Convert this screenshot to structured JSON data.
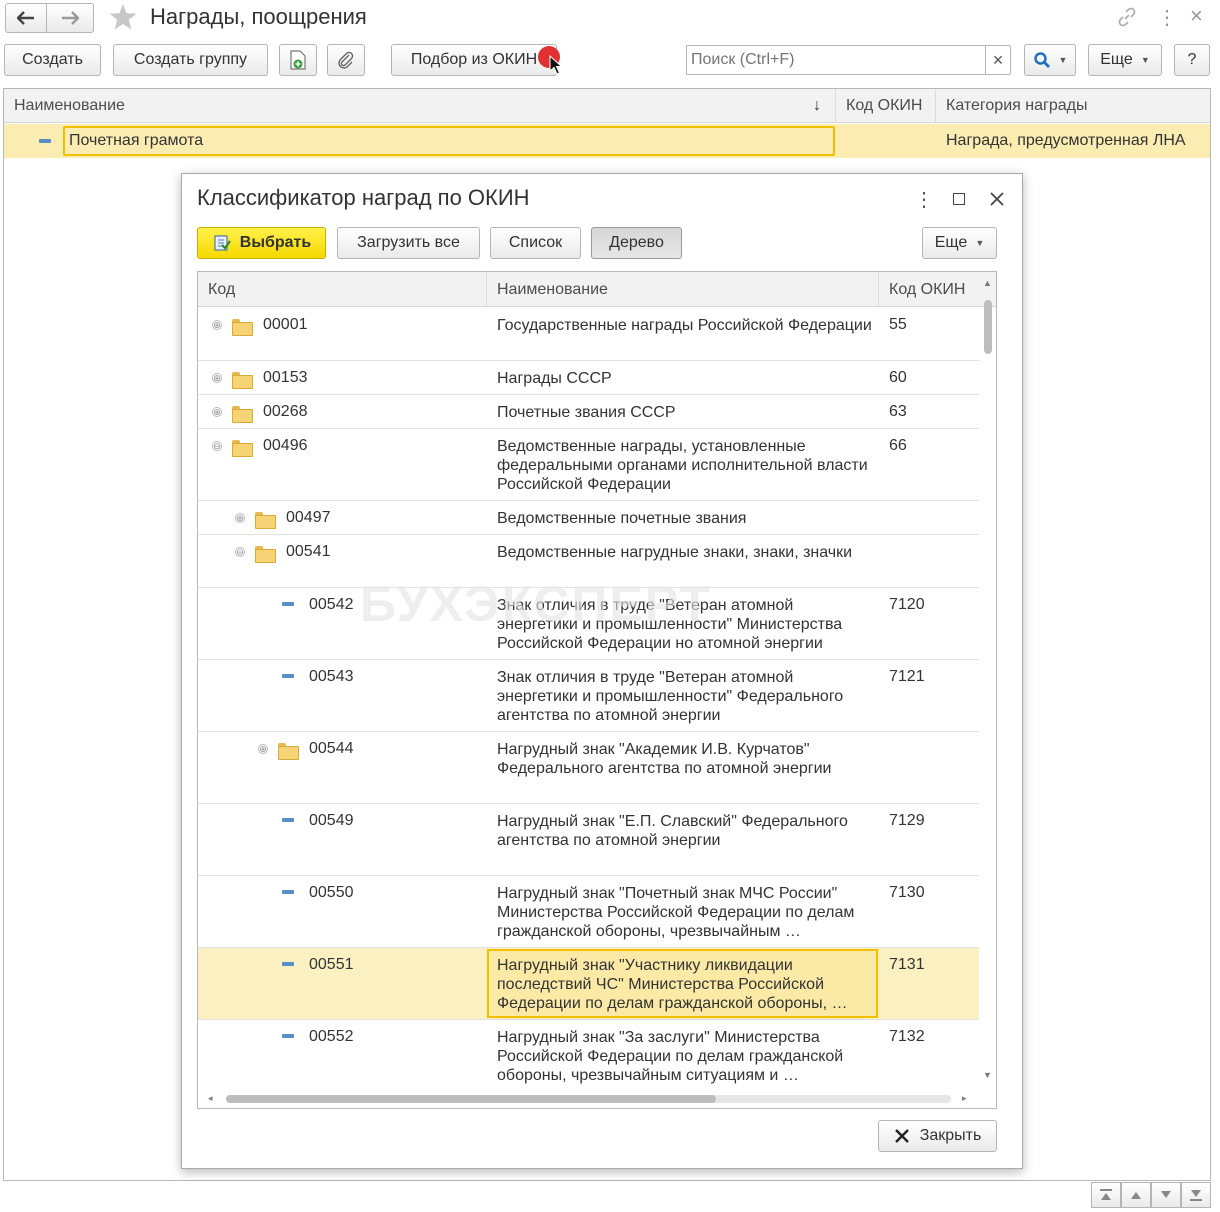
{
  "window": {
    "title": "Награды, поощрения",
    "toolbar": {
      "create": "Создать",
      "create_group": "Создать группу",
      "pick_okin": "Подбор из ОКИН",
      "search_placeholder": "Поиск (Ctrl+F)",
      "clear": "×",
      "more": "Еще",
      "help": "?"
    },
    "columns": [
      "Наименование",
      "Код ОКИН",
      "Категория награды"
    ],
    "sort_indicator": "↓",
    "rows": [
      {
        "name": "Почетная грамота",
        "okin": "",
        "category": "Награда, предусмотренная ЛНА"
      }
    ]
  },
  "dialog": {
    "title": "Классификатор наград по ОКИН",
    "menu_icon": "⋮",
    "buttons": {
      "select": "Выбрать",
      "load_all": "Загрузить все",
      "list": "Список",
      "tree": "Дерево",
      "more": "Еще",
      "close": "Закрыть"
    },
    "columns": [
      "Код",
      "Наименование",
      "Код ОКИН"
    ],
    "rows": [
      {
        "code": "00001",
        "name": "Государственные награды Российской Федерации",
        "okin": "55",
        "kind": "folder",
        "expander": "⊕"
      },
      {
        "code": "00153",
        "name": "Награды СССР",
        "okin": "60",
        "kind": "folder",
        "expander": "⊕"
      },
      {
        "code": "00268",
        "name": "Почетные звания СССР",
        "okin": "63",
        "kind": "folder",
        "expander": "⊕"
      },
      {
        "code": "00496",
        "name": "Ведомственные награды, установленные федеральными органами исполнительной власти Российской Федерации",
        "okin": "66",
        "kind": "folder",
        "expander": "⊖"
      },
      {
        "code": "00497",
        "name": "Ведомственные почетные звания",
        "okin": "",
        "kind": "folder",
        "expander": "⊕"
      },
      {
        "code": "00541",
        "name": "Ведомственные нагрудные знаки, знаки, значки",
        "okin": "",
        "kind": "folder",
        "expander": "⊖"
      },
      {
        "code": "00542",
        "name": "Знак отличия в труде \"Ветеран атомной энергетики и промышленности\" Министерства Российской Федерации но атомной энергии",
        "okin": "7120",
        "kind": "item",
        "expander": ""
      },
      {
        "code": "00543",
        "name": "Знак отличия в труде \"Ветеран атомной энергетики и промышленности\" Федерального агентства по атомной энергии",
        "okin": "7121",
        "kind": "item",
        "expander": ""
      },
      {
        "code": "00544",
        "name": "Нагрудный знак \"Академик И.В. Курчатов\" Федерального агентства по атомной энергии",
        "okin": "",
        "kind": "folder",
        "expander": "⊕"
      },
      {
        "code": "00549",
        "name": "Нагрудный знак \"Е.П. Славский\" Федерального агентства по атомной энергии",
        "okin": "7129",
        "kind": "item",
        "expander": ""
      },
      {
        "code": "00550",
        "name": "Нагрудный знак \"Почетный знак МЧС России\" Министерства Российской Федерации по делам гражданской обороны, чрезвычайным …",
        "okin": "7130",
        "kind": "item",
        "expander": ""
      },
      {
        "code": "00551",
        "name": "Нагрудный знак \"Участнику ликвидации последствий ЧС\" Министерства Российской Федерации по делам гражданской обороны, …",
        "okin": "7131",
        "kind": "item",
        "expander": ""
      },
      {
        "code": "00552",
        "name": "Нагрудный знак \"За заслуги\" Министерства Российской Федерации по делам гражданской обороны, чрезвычайным ситуациям и …",
        "okin": "7132",
        "kind": "item",
        "expander": ""
      }
    ]
  },
  "watermark": "БУХЭКСПЕРТ"
}
